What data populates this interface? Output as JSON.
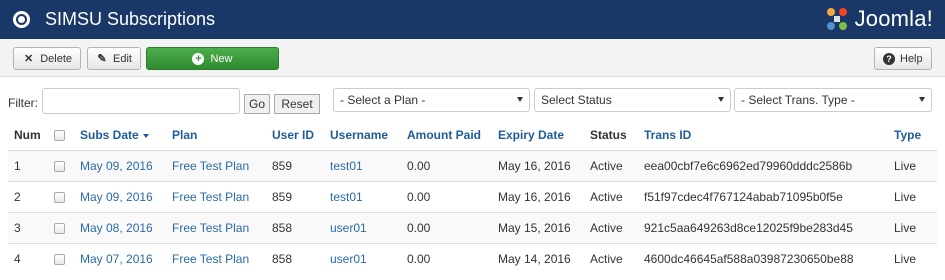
{
  "header": {
    "title": "SIMSU Subscriptions",
    "logo_text": "Joomla!"
  },
  "toolbar": {
    "delete_label": "Delete",
    "edit_label": "Edit",
    "new_label": "New",
    "help_label": "Help"
  },
  "filter": {
    "label": "Filter:",
    "value": "",
    "go_label": "Go",
    "reset_label": "Reset",
    "plan_select": "- Select a Plan -",
    "status_select": "Select Status",
    "type_select": "- Select Trans. Type -"
  },
  "table": {
    "columns": [
      "Num",
      "",
      "Subs Date",
      "Plan",
      "User ID",
      "Username",
      "Amount Paid",
      "Expiry Date",
      "Status",
      "Trans ID",
      "Type"
    ],
    "rows": [
      {
        "num": "1",
        "subs_date": "May 09, 2016",
        "plan": "Free Test Plan",
        "user_id": "859",
        "username": "test01",
        "amount": "0.00",
        "expiry": "May 16, 2016",
        "status": "Active",
        "trans_id": "eea00cbf7e6c6962ed79960dddc2586b",
        "type": "Live"
      },
      {
        "num": "2",
        "subs_date": "May 09, 2016",
        "plan": "Free Test Plan",
        "user_id": "859",
        "username": "test01",
        "amount": "0.00",
        "expiry": "May 16, 2016",
        "status": "Active",
        "trans_id": "f51f97cdec4f767124abab71095b0f5e",
        "type": "Live"
      },
      {
        "num": "3",
        "subs_date": "May 08, 2016",
        "plan": "Free Test Plan",
        "user_id": "858",
        "username": "user01",
        "amount": "0.00",
        "expiry": "May 15, 2016",
        "status": "Active",
        "trans_id": "921c5aa649263d8ce12025f9be283d45",
        "type": "Live"
      },
      {
        "num": "4",
        "subs_date": "May 07, 2016",
        "plan": "Free Test Plan",
        "user_id": "858",
        "username": "user01",
        "amount": "0.00",
        "expiry": "May 14, 2016",
        "status": "Active",
        "trans_id": "4600dc46645af588a03987230650be88",
        "type": "Live"
      }
    ]
  }
}
